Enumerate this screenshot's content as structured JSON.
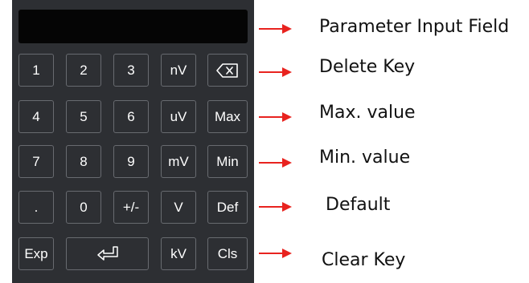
{
  "keypad": {
    "keys": [
      [
        "1",
        "2",
        "3",
        "nV",
        ""
      ],
      [
        "4",
        "5",
        "6",
        "uV",
        "Max"
      ],
      [
        "7",
        "8",
        "9",
        "mV",
        "Min"
      ],
      [
        ".",
        "0",
        "+/-",
        "V",
        "Def"
      ],
      [
        "Exp",
        "",
        "kV",
        "Cls"
      ]
    ],
    "icons": {
      "delete": "backspace-icon",
      "enter": "enter-icon"
    }
  },
  "annotations": {
    "input_field": "Parameter Input Field",
    "delete_key": "Delete Key",
    "max_value": "Max. value",
    "min_value": "Min. value",
    "default": "Default",
    "clear_key": "Clear Key"
  },
  "colors": {
    "panel": "#2d2f33",
    "display": "#050505",
    "key_border": "#686b70",
    "key_text": "#ffffff",
    "arrow": "#e8231f"
  }
}
